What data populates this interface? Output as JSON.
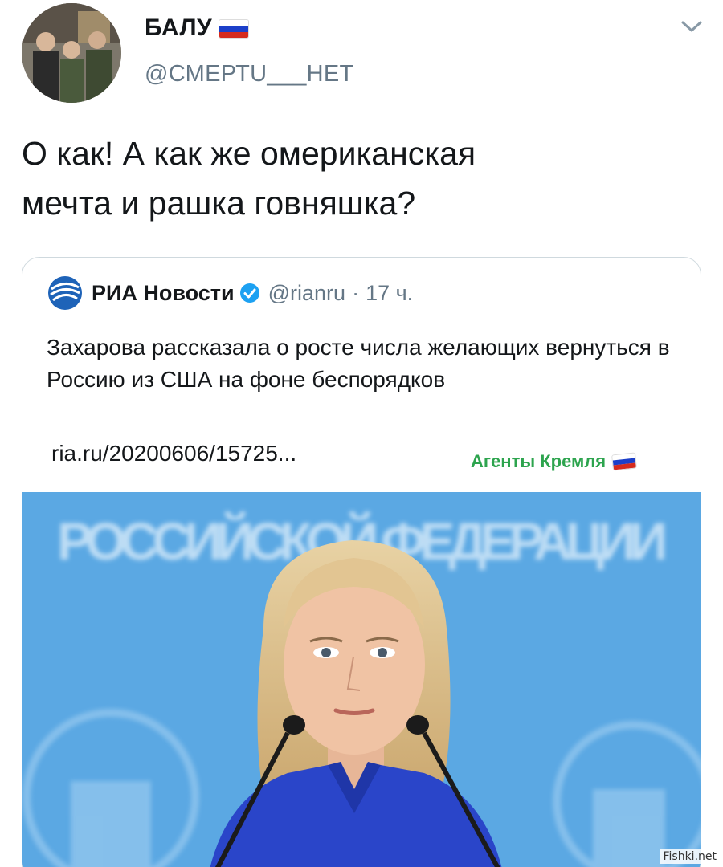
{
  "tweet": {
    "display_name": "БАЛУ",
    "handle": "@СМЕРТU___НЕТ",
    "text_line1": "О как! А как же омериканская",
    "text_line2": "мечта и рашка говняшка?",
    "menu_icon": "chevron-down-icon",
    "flag_icon": "russia-flag-icon"
  },
  "quote": {
    "author_name": "РИА Новости",
    "author_handle": "@rianru",
    "separator": "·",
    "time_ago": "17 ч.",
    "text": "Захарова рассказала о росте числа желающих вернуться в Россию из США на фоне беспорядков",
    "link": "ria.ru/20200606/15725...",
    "image_banner_text": "РОССИЙСКОЙ ФЕДЕРАЦИИ",
    "verified_icon": "verified-badge-icon"
  },
  "overlay": {
    "channel_watermark": "Агенты Кремля",
    "site_watermark": "Fishki.net"
  },
  "colors": {
    "text": "#14171a",
    "muted": "#657786",
    "verified": "#1da1f2",
    "watermark_green": "#2da44e",
    "image_bg": "#5aa7e2"
  }
}
